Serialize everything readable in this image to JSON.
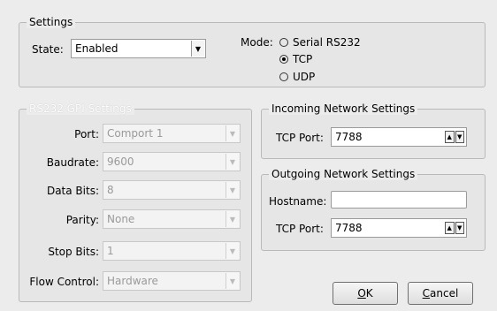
{
  "settings": {
    "title": "Settings",
    "state_label": "State:",
    "state_value": "Enabled",
    "mode_label": "Mode:",
    "modes": [
      {
        "label": "Serial RS232",
        "selected": false
      },
      {
        "label": "TCP",
        "selected": true
      },
      {
        "label": "UDP",
        "selected": false
      }
    ]
  },
  "rs232": {
    "title": "RS232 GPI Settings",
    "port_label": "Port:",
    "port_value": "Comport 1",
    "baud_label": "Baudrate:",
    "baud_value": "9600",
    "databits_label": "Data Bits:",
    "databits_value": "8",
    "parity_label": "Parity:",
    "parity_value": "None",
    "stopbits_label": "Stop Bits:",
    "stopbits_value": "1",
    "flow_label": "Flow Control:",
    "flow_value": "Hardware"
  },
  "incoming": {
    "title": "Incoming Network Settings",
    "tcp_label": "TCP Port:",
    "tcp_value": "7788"
  },
  "outgoing": {
    "title": "Outgoing Network Settings",
    "host_label": "Hostname:",
    "host_value": "",
    "tcp_label": "TCP Port:",
    "tcp_value": "7788"
  },
  "buttons": {
    "ok_mnemonic": "O",
    "ok_rest": "K",
    "cancel_mnemonic": "C",
    "cancel_rest": "ancel"
  }
}
